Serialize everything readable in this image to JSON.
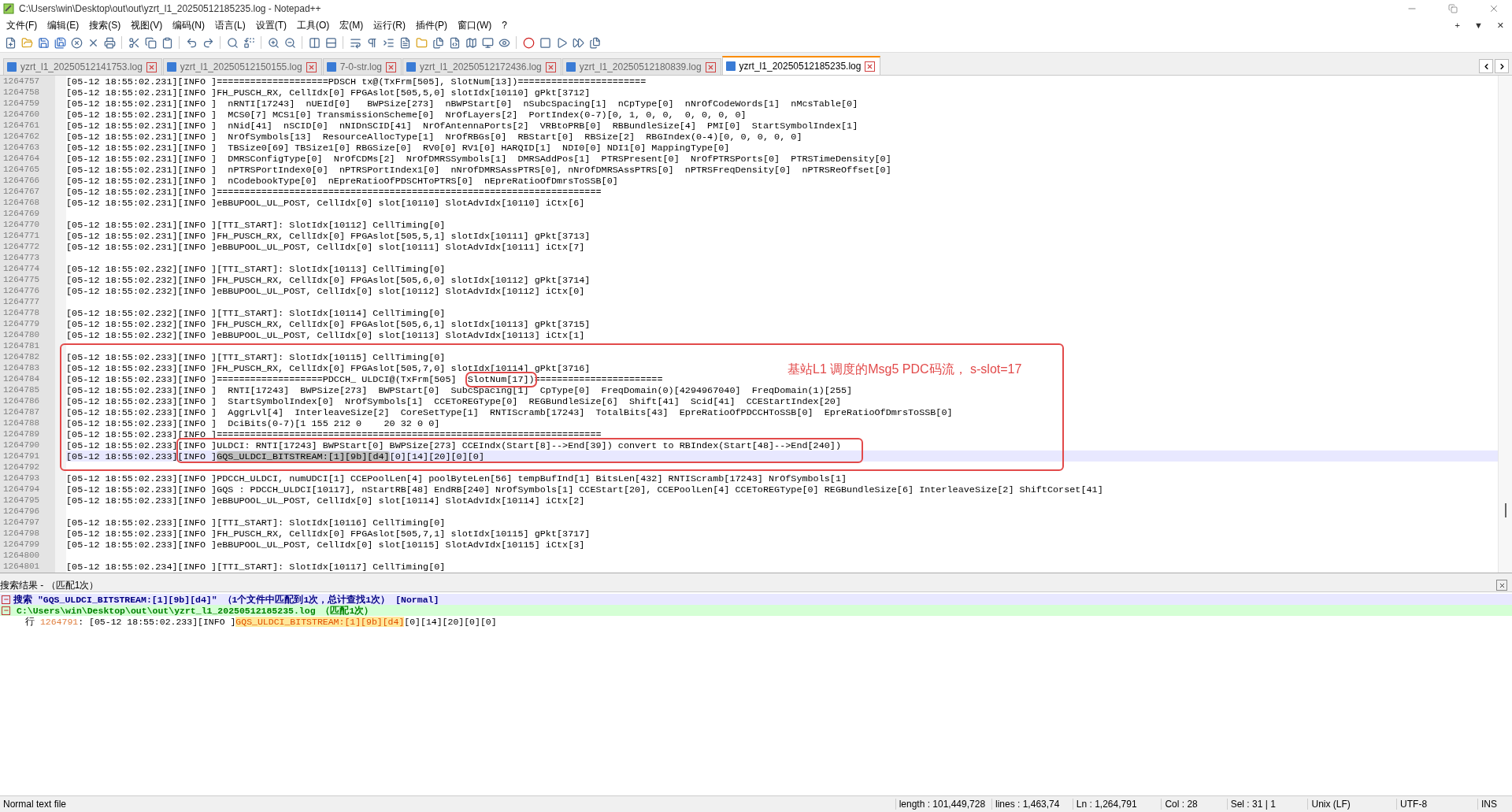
{
  "window": {
    "title": "C:\\Users\\win\\Desktop\\out\\out\\yzrt_l1_20250512185235.log - Notepad++"
  },
  "menu": [
    "文件(F)",
    "编辑(E)",
    "搜索(S)",
    "视图(V)",
    "编码(N)",
    "语言(L)",
    "设置(T)",
    "工具(O)",
    "宏(M)",
    "运行(R)",
    "插件(P)",
    "窗口(W)",
    "?"
  ],
  "menu_right": [
    "+",
    "▼",
    "✕"
  ],
  "tabs": [
    {
      "label": "yzrt_l1_20250512141753.log",
      "selected": false
    },
    {
      "label": "yzrt_l1_20250512150155.log",
      "selected": false
    },
    {
      "label": "7-0-str.log",
      "selected": false
    },
    {
      "label": "yzrt_l1_20250512172436.log",
      "selected": false
    },
    {
      "label": "yzrt_l1_20250512180839.log",
      "selected": false
    },
    {
      "label": "yzrt_l1_20250512185235.log",
      "selected": true
    }
  ],
  "editor": {
    "lines": [
      {
        "number": "1264757",
        "current": false,
        "text": "[05-12 18:55:02.231][INFO ]====================PDSCH tx@(TxFrm[505], SlotNum[13])======================="
      },
      {
        "number": "1264758",
        "current": false,
        "text": "[05-12 18:55:02.231][INFO ]FH_PUSCH_RX, CellIdx[0] FPGAslot[505,5,0] slotIdx[10110] gPkt[3712]"
      },
      {
        "number": "1264759",
        "current": false,
        "text": "[05-12 18:55:02.231][INFO ]  nRNTI[17243]  nUEId[0]   BWPSize[273]  nBWPStart[0]  nSubcSpacing[1]  nCpType[0]  nNrOfCodeWords[1]  nMcsTable[0]"
      },
      {
        "number": "1264760",
        "current": false,
        "text": "[05-12 18:55:02.231][INFO ]  MCS0[7] MCS1[0] TransmissionScheme[0]  NrOfLayers[2]  PortIndex(0-7)[0, 1, 0, 0,  0, 0, 0, 0]"
      },
      {
        "number": "1264761",
        "current": false,
        "text": "[05-12 18:55:02.231][INFO ]  nNid[41]  nSCID[0]  nNIDnSCID[41]  NrOfAntennaPorts[2]  VRBtoPRB[0]  RBBundleSize[4]  PMI[0]  StartSymbolIndex[1]"
      },
      {
        "number": "1264762",
        "current": false,
        "text": "[05-12 18:55:02.231][INFO ]  NrOfSymbols[13]  ResourceAllocType[1]  NrOfRBGs[0]  RBStart[0]  RBSize[2]  RBGIndex(0-4)[0, 0, 0, 0, 0]"
      },
      {
        "number": "1264763",
        "current": false,
        "text": "[05-12 18:55:02.231][INFO ]  TBSize0[69] TBSize1[0] RBGSize[0]  RV0[0] RV1[0] HARQID[1]  NDI0[0] NDI1[0] MappingType[0]"
      },
      {
        "number": "1264764",
        "current": false,
        "text": "[05-12 18:55:02.231][INFO ]  DMRSConfigType[0]  NrOfCDMs[2]  NrOfDMRSSymbols[1]  DMRSAddPos[1]  PTRSPresent[0]  NrOfPTRSPorts[0]  PTRSTimeDensity[0]"
      },
      {
        "number": "1264765",
        "current": false,
        "text": "[05-12 18:55:02.231][INFO ]  nPTRSPortIndex0[0]  nPTRSPortIndex1[0]  nNrOfDMRSAssPTRS[0], nNrOfDMRSAssPTRS[0]  nPTRSFreqDensity[0]  nPTRSReOffset[0]"
      },
      {
        "number": "1264766",
        "current": false,
        "text": "[05-12 18:55:02.231][INFO ]  nCodebookType[0]  nEpreRatioOfPDSCHToPTRS[0]  nEpreRatioOfDmrsToSSB[0]"
      },
      {
        "number": "1264767",
        "current": false,
        "text": "[05-12 18:55:02.231][INFO ]====================================================================="
      },
      {
        "number": "1264768",
        "current": false,
        "text": "[05-12 18:55:02.231][INFO ]eBBUPOOL_UL_POST, CellIdx[0] slot[10110] SlotAdvIdx[10110] iCtx[6]"
      },
      {
        "number": "1264769",
        "current": false
      },
      {
        "number": "1264770",
        "current": false,
        "text": "[05-12 18:55:02.231][INFO ][TTI_START]: SlotIdx[10112] CellTiming[0]"
      },
      {
        "number": "1264771",
        "current": false,
        "text": "[05-12 18:55:02.231][INFO ]FH_PUSCH_RX, CellIdx[0] FPGAslot[505,5,1] slotIdx[10111] gPkt[3713]"
      },
      {
        "number": "1264772",
        "current": false,
        "text": "[05-12 18:55:02.231][INFO ]eBBUPOOL_UL_POST, CellIdx[0] slot[10111] SlotAdvIdx[10111] iCtx[7]"
      },
      {
        "number": "1264773",
        "current": false
      },
      {
        "number": "1264774",
        "current": false,
        "text": "[05-12 18:55:02.232][INFO ][TTI_START]: SlotIdx[10113] CellTiming[0]"
      },
      {
        "number": "1264775",
        "current": false,
        "text": "[05-12 18:55:02.232][INFO ]FH_PUSCH_RX, CellIdx[0] FPGAslot[505,6,0] slotIdx[10112] gPkt[3714]"
      },
      {
        "number": "1264776",
        "current": false,
        "text": "[05-12 18:55:02.232][INFO ]eBBUPOOL_UL_POST, CellIdx[0] slot[10112] SlotAdvIdx[10112] iCtx[0]"
      },
      {
        "number": "1264777",
        "current": false
      },
      {
        "number": "1264778",
        "current": false,
        "text": "[05-12 18:55:02.232][INFO ][TTI_START]: SlotIdx[10114] CellTiming[0]"
      },
      {
        "number": "1264779",
        "current": false,
        "text": "[05-12 18:55:02.232][INFO ]FH_PUSCH_RX, CellIdx[0] FPGAslot[505,6,1] slotIdx[10113] gPkt[3715]"
      },
      {
        "number": "1264780",
        "current": false,
        "text": "[05-12 18:55:02.232][INFO ]eBBUPOOL_UL_POST, CellIdx[0] slot[10113] SlotAdvIdx[10113] iCtx[1]"
      },
      {
        "number": "1264781",
        "current": false
      },
      {
        "number": "1264782",
        "current": false,
        "text": "[05-12 18:55:02.233][INFO ][TTI_START]: SlotIdx[10115] CellTiming[0]"
      },
      {
        "number": "1264783",
        "current": false,
        "text": "[05-12 18:55:02.233][INFO ]FH_PUSCH_RX, CellIdx[0] FPGAslot[505,7,0] slotIdx[10114] gPkt[3716]"
      },
      {
        "number": "1264784",
        "current": false,
        "segments": [
          {
            "text": "[05-12 18:55:02.233][INFO ]===================PDCCH_ ULDCI@(TxFrm[505]  ",
            "framed": false
          },
          {
            "text": "SlotNum[17])",
            "framed": true
          },
          {
            "text": "=======================",
            "framed": false
          }
        ]
      },
      {
        "number": "1264785",
        "current": false,
        "text": "[05-12 18:55:02.233][INFO ]  RNTI[17243]  BWPSize[273]  BWPStart[0]  SubcSpacing[1]  CpType[0]  FreqDomain(0)[4294967040]  FreqDomain(1)[255]"
      },
      {
        "number": "1264786",
        "current": false,
        "text": "[05-12 18:55:02.233][INFO ]  StartSymbolIndex[0]  NrOfSymbols[1]  CCEToREGType[0]  REGBundleSize[6]  Shift[41]  Scid[41]  CCEStartIndex[20]"
      },
      {
        "number": "1264787",
        "current": false,
        "text": "[05-12 18:55:02.233][INFO ]  AggrLvl[4]  InterleaveSize[2]  CoreSetType[1]  RNTIScramb[17243]  TotalBits[43]  EpreRatioOfPDCCHToSSB[0]  EpreRatioOfDmrsToSSB[0]"
      },
      {
        "number": "1264788",
        "current": false,
        "text": "[05-12 18:55:02.233][INFO ]  DciBits(0-7)[1 155 212 0    20 32 0 0]"
      },
      {
        "number": "1264789",
        "current": false,
        "text": "[05-12 18:55:02.233][INFO ]====================================================================="
      },
      {
        "number": "1264790",
        "current": false,
        "text": "[05-12 18:55:02.233][INFO ]ULDCI: RNTI[17243] BWPStart[0] BWPSize[273] CCEIndx(Start[8]-->End[39]) convert to RBIndex(Start[48]-->End[240])"
      },
      {
        "number": "1264791",
        "current": true,
        "segments": [
          {
            "text": "[05-12 18:55:02.233][INFO ]",
            "selected": false
          },
          {
            "text": "GQS_ULDCI_BITSTREAM:[1][9b][d4]",
            "selected": true
          },
          {
            "text": "[0][14][20][0][0]",
            "selected": false
          }
        ]
      },
      {
        "number": "1264792",
        "current": false
      },
      {
        "number": "1264793",
        "current": false,
        "text": "[05-12 18:55:02.233][INFO ]PDCCH_ULDCI, numUDCI[1] CCEPoolLen[4] poolByteLen[56] tempBufInd[1] BitsLen[432] RNTIScramb[17243] NrOfSymbols[1]"
      },
      {
        "number": "1264794",
        "current": false,
        "text": "[05-12 18:55:02.233][INFO ]GQS : PDCCH_ULDCI[10117], nStartRB[48] EndRB[240] NrOfSymbols[1] CCEStart[20], CCEPoolLen[4] CCEToREGType[0] REGBundleSize[6] InterleaveSize[2] ShiftCorset[41]"
      },
      {
        "number": "1264795",
        "current": false,
        "text": "[05-12 18:55:02.233][INFO ]eBBUPOOL_UL_POST, CellIdx[0] slot[10114] SlotAdvIdx[10114] iCtx[2]"
      },
      {
        "number": "1264796",
        "current": false
      },
      {
        "number": "1264797",
        "current": false,
        "text": "[05-12 18:55:02.233][INFO ][TTI_START]: SlotIdx[10116] CellTiming[0]"
      },
      {
        "number": "1264798",
        "current": false,
        "text": "[05-12 18:55:02.233][INFO ]FH_PUSCH_RX, CellIdx[0] FPGAslot[505,7,1] slotIdx[10115] gPkt[3717]"
      },
      {
        "number": "1264799",
        "current": false,
        "text": "[05-12 18:55:02.233][INFO ]eBBUPOOL_UL_POST, CellIdx[0] slot[10115] SlotAdvIdx[10115] iCtx[3]"
      },
      {
        "number": "1264800",
        "current": false
      },
      {
        "number": "1264801",
        "current": false,
        "text": "[05-12 18:55:02.234][INFO ][TTI_START]: SlotIdx[10117] CellTiming[0]"
      }
    ],
    "annotations": [
      {
        "kind": "frame"
      },
      {
        "kind": "frame"
      },
      {
        "kind": "note",
        "text": "基站L1 调度的Msg5 PDC码流，  s-slot=17"
      }
    ]
  },
  "search_results": {
    "title": "搜索结果 - （匹配1次）",
    "query": "搜索 \"GQS_ULDCI_BITSTREAM:[1][9b][d4]\" （1个文件中匹配到1次，总计查找1次） [Normal]",
    "file": "C:\\Users\\win\\Desktop\\out\\out\\yzrt_l1_20250512185235.log （匹配1次）",
    "hit": {
      "label": "行",
      "number": "1264791",
      "before": ": [05-12 18:55:02.233][INFO ]",
      "match": "GQS_ULDCI_BITSTREAM:[1][9b][d4]",
      "after": "[0][14][20][0][0]"
    }
  },
  "status_bar": [
    "Normal text file",
    "length : 101,449,728",
    "lines : 1,463,74",
    "Ln : 1,264,791",
    "Col : 28",
    "Sel : 31 | 1",
    "Unix (LF)",
    "UTF-8",
    "INS"
  ]
}
